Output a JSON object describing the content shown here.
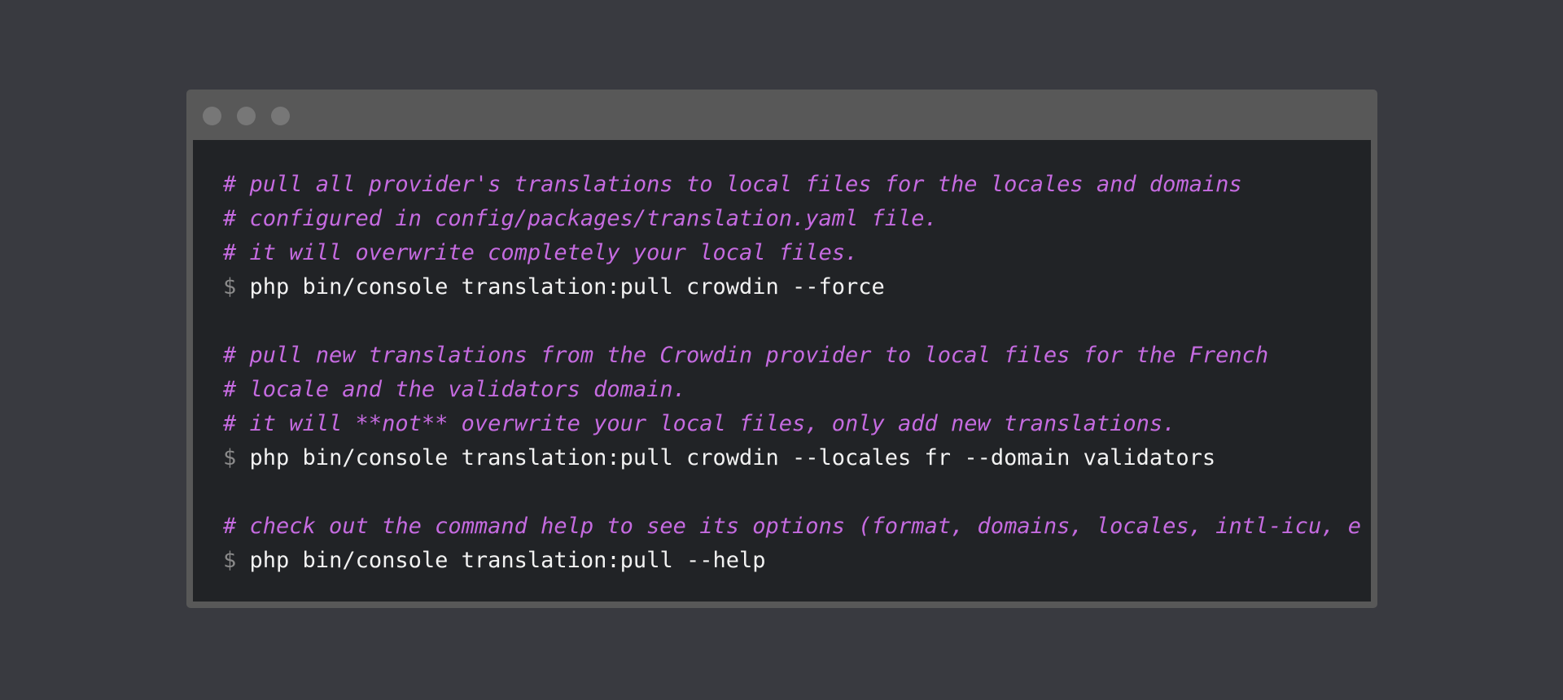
{
  "terminal": {
    "prompt_symbol": "$",
    "lines": [
      {
        "type": "comment",
        "text": "# pull all provider's translations to local files for the locales and domains"
      },
      {
        "type": "comment",
        "text": "# configured in config/packages/translation.yaml file."
      },
      {
        "type": "comment",
        "text": "# it will overwrite completely your local files."
      },
      {
        "type": "command",
        "text": "php bin/console translation:pull crowdin --force"
      },
      {
        "type": "blank",
        "text": ""
      },
      {
        "type": "comment",
        "text": "# pull new translations from the Crowdin provider to local files for the French"
      },
      {
        "type": "comment",
        "text": "# locale and the validators domain."
      },
      {
        "type": "comment",
        "text": "# it will **not** overwrite your local files, only add new translations."
      },
      {
        "type": "command",
        "text": "php bin/console translation:pull crowdin --locales fr --domain validators"
      },
      {
        "type": "blank",
        "text": ""
      },
      {
        "type": "comment",
        "text": "# check out the command help to see its options (format, domains, locales, intl-icu, e"
      },
      {
        "type": "command",
        "text": "php bin/console translation:pull --help"
      }
    ]
  },
  "colors": {
    "background": "#393a40",
    "window_frame": "#585858",
    "terminal_bg": "#212326",
    "comment": "#c56be0",
    "prompt": "#8a8a8a",
    "command": "#f2f2f2"
  }
}
